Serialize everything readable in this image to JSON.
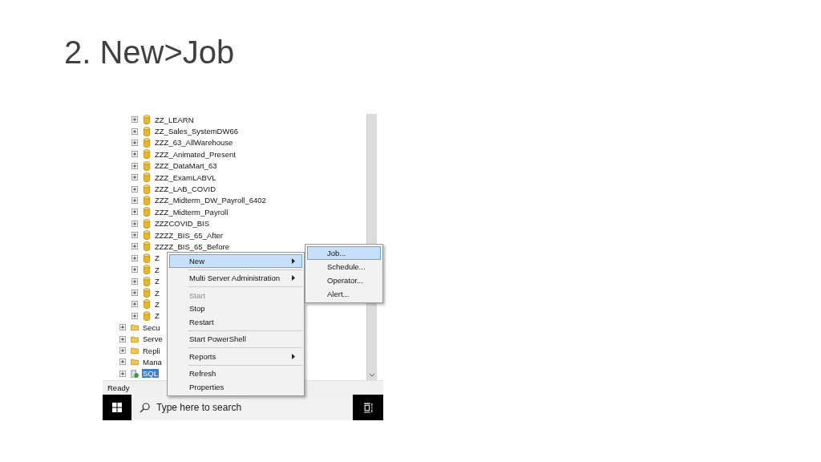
{
  "slide": {
    "title": "2. New>Job"
  },
  "tree": {
    "databases": [
      {
        "label": "ZZ_LEARN"
      },
      {
        "label": "ZZ_Sales_SystemDW66"
      },
      {
        "label": "ZZZ_63_AllWarehouse"
      },
      {
        "label": "ZZZ_Animated_Present"
      },
      {
        "label": "ZZZ_DataMart_63"
      },
      {
        "label": "ZZZ_ExamLABVL"
      },
      {
        "label": "ZZZ_LAB_COVID"
      },
      {
        "label": "ZZZ_Midterm_DW_Payroll_6402"
      },
      {
        "label": "ZZZ_Midterm_Payroll"
      },
      {
        "label": "ZZZCOVID_BIS"
      },
      {
        "label": "ZZZZ_BIS_65_After"
      },
      {
        "label": "ZZZZ_BIS_65_Before"
      },
      {
        "label": "Z"
      },
      {
        "label": "Z"
      },
      {
        "label": "Z"
      },
      {
        "label": "Z"
      },
      {
        "label": "Z"
      },
      {
        "label": "Z"
      }
    ],
    "folders": [
      {
        "label": "Secu",
        "kind": "folder",
        "selected": false
      },
      {
        "label": "Serve",
        "kind": "folder",
        "selected": false
      },
      {
        "label": "Repli",
        "kind": "folder",
        "selected": false
      },
      {
        "label": "Mana",
        "kind": "folder",
        "selected": false
      },
      {
        "label": "SQL",
        "kind": "agent",
        "selected": true
      }
    ]
  },
  "status_bar": {
    "text": "Ready"
  },
  "context_menu": {
    "items": [
      {
        "kind": "item",
        "label": "New",
        "submenu": true,
        "selected": true,
        "disabled": false
      },
      {
        "kind": "separator"
      },
      {
        "kind": "item",
        "label": "Multi Server Administration",
        "submenu": true,
        "selected": false,
        "disabled": false
      },
      {
        "kind": "separator"
      },
      {
        "kind": "item",
        "label": "Start",
        "submenu": false,
        "selected": false,
        "disabled": true
      },
      {
        "kind": "item",
        "label": "Stop",
        "submenu": false,
        "selected": false,
        "disabled": false
      },
      {
        "kind": "item",
        "label": "Restart",
        "submenu": false,
        "selected": false,
        "disabled": false
      },
      {
        "kind": "separator"
      },
      {
        "kind": "item",
        "label": "Start PowerShell",
        "submenu": false,
        "selected": false,
        "disabled": false
      },
      {
        "kind": "separator"
      },
      {
        "kind": "item",
        "label": "Reports",
        "submenu": true,
        "selected": false,
        "disabled": false
      },
      {
        "kind": "separator"
      },
      {
        "kind": "item",
        "label": "Refresh",
        "submenu": false,
        "selected": false,
        "disabled": false
      },
      {
        "kind": "item",
        "label": "Properties",
        "submenu": false,
        "selected": false,
        "disabled": false
      }
    ]
  },
  "submenu": {
    "items": [
      {
        "label": "Job...",
        "selected": true
      },
      {
        "label": "Schedule...",
        "selected": false
      },
      {
        "label": "Operator...",
        "selected": false
      },
      {
        "label": "Alert...",
        "selected": false
      }
    ]
  },
  "taskbar": {
    "search": {
      "placeholder": "Type here to search"
    }
  }
}
